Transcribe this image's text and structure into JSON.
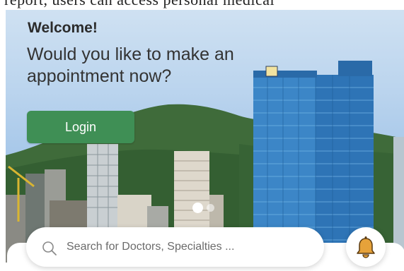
{
  "top_cut_text": "report, users can access personal medical",
  "hero": {
    "welcome_title": "Welcome!",
    "welcome_question": "Would you like to make an appointment now?",
    "login_label": "Login",
    "carousel": {
      "page_count": 2,
      "active_index": 0
    }
  },
  "search": {
    "placeholder": "Search for Doctors, Specialties ...",
    "icon": "search-icon"
  },
  "notifications": {
    "icon": "bell-icon"
  },
  "colors": {
    "accent_green": "#3f8f55",
    "bell_gold": "#e6a23a",
    "text_dark": "#2b2b2b"
  }
}
